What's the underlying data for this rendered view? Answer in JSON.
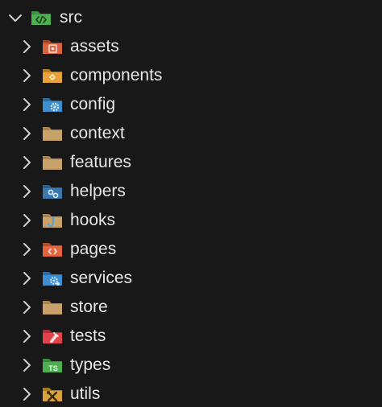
{
  "explorer": {
    "root": {
      "label": "src",
      "expanded": true,
      "icon": "folder-src-icon",
      "color": "#4caf50"
    },
    "items": [
      {
        "label": "assets",
        "icon": "folder-assets-icon",
        "color": "#d9643f"
      },
      {
        "label": "components",
        "icon": "folder-components-icon",
        "color": "#e8a33a"
      },
      {
        "label": "config",
        "icon": "folder-config-icon",
        "color": "#3f8fd0"
      },
      {
        "label": "context",
        "icon": "folder-icon",
        "color": "#c9a26b"
      },
      {
        "label": "features",
        "icon": "folder-icon",
        "color": "#c9a26b"
      },
      {
        "label": "helpers",
        "icon": "folder-helpers-icon",
        "color": "#3f8fd0"
      },
      {
        "label": "hooks",
        "icon": "folder-hooks-icon",
        "color": "#c9a26b"
      },
      {
        "label": "pages",
        "icon": "folder-pages-icon",
        "color": "#e3643f"
      },
      {
        "label": "services",
        "icon": "folder-services-icon",
        "color": "#3f8fd0"
      },
      {
        "label": "store",
        "icon": "folder-icon",
        "color": "#c9a26b"
      },
      {
        "label": "tests",
        "icon": "folder-tests-icon",
        "color": "#e0434a"
      },
      {
        "label": "types",
        "icon": "folder-types-icon",
        "color": "#4caf50",
        "badge": "TS"
      },
      {
        "label": "utils",
        "icon": "folder-utils-icon",
        "color": "#d9a23a"
      }
    ]
  }
}
